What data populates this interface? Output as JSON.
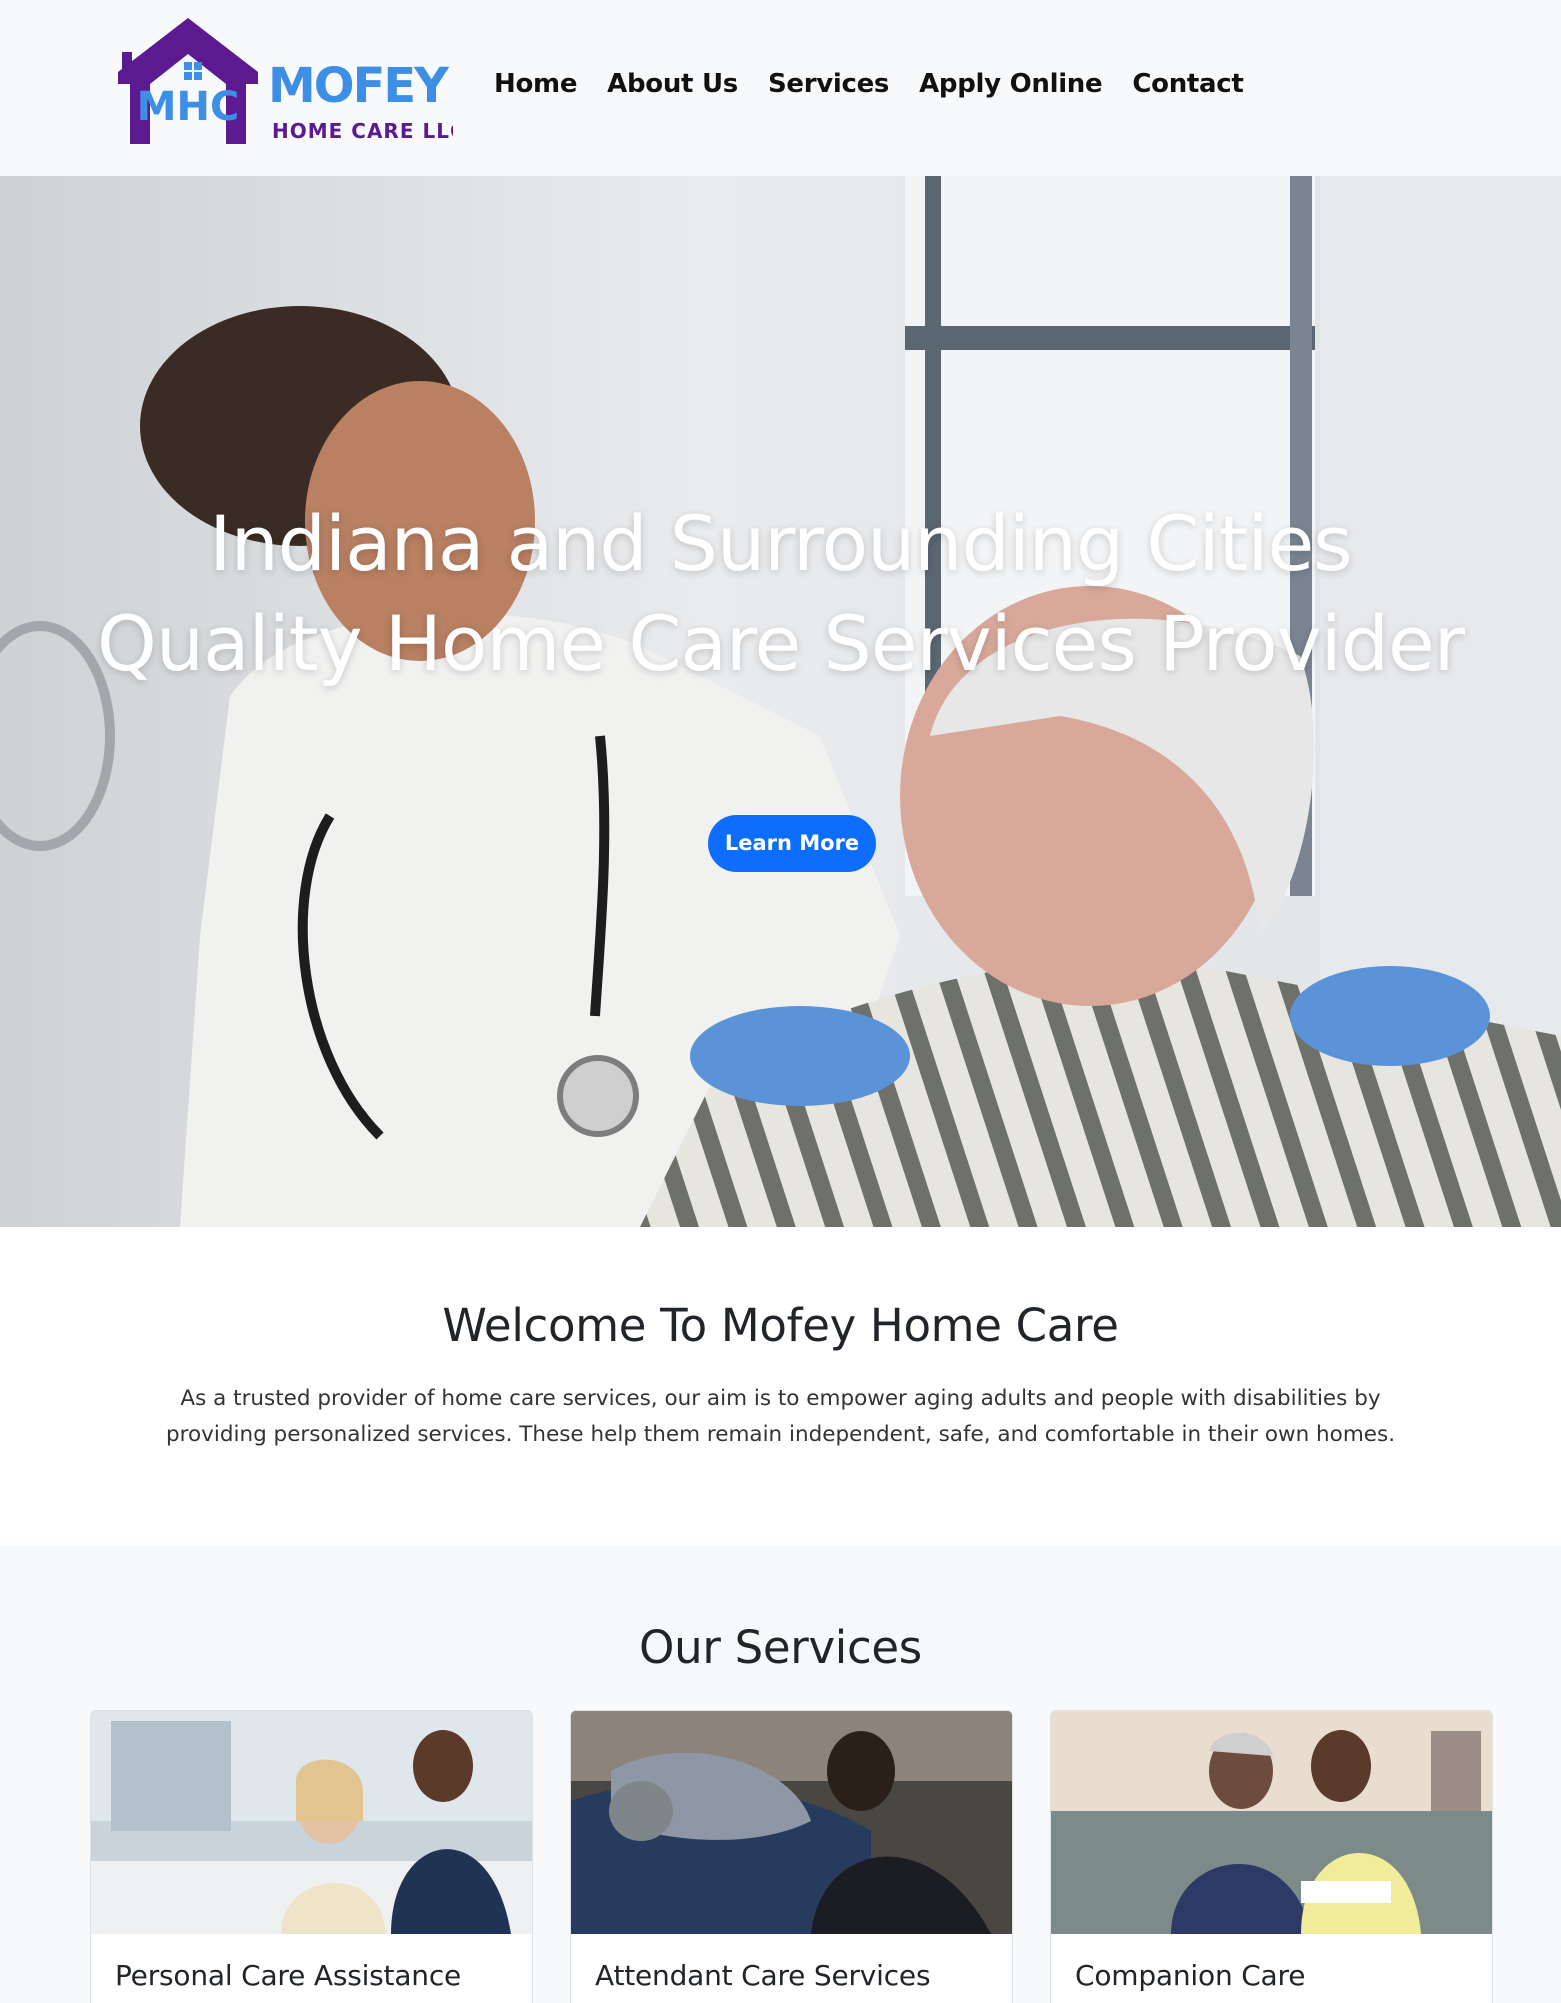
{
  "brand": {
    "logo_initials": "MHC",
    "logo_name": "MOFEY",
    "logo_tagline": "HOME CARE LLC",
    "colors": {
      "purple": "#5b1a8f",
      "blue": "#3d8fe6"
    }
  },
  "nav": {
    "items": [
      {
        "label": "Home"
      },
      {
        "label": "About Us"
      },
      {
        "label": "Services"
      },
      {
        "label": "Apply Online"
      },
      {
        "label": "Contact"
      }
    ]
  },
  "hero": {
    "title_line1": "Indiana and Surrounding Cities",
    "title_line2": "Quality Home Care Services Provider",
    "button_label": "Learn More",
    "button_color": "#0d6efd"
  },
  "welcome": {
    "heading": "Welcome To Mofey Home Care",
    "body": "As a trusted provider of home care services, our aim is to empower aging adults and people with disabilities by providing personalized services. These help them remain independent, safe, and comfortable in their own homes."
  },
  "services": {
    "heading": "Our Services",
    "cards": [
      {
        "title": "Personal Care Assistance"
      },
      {
        "title": "Attendant Care Services"
      },
      {
        "title": "Companion Care"
      }
    ]
  }
}
